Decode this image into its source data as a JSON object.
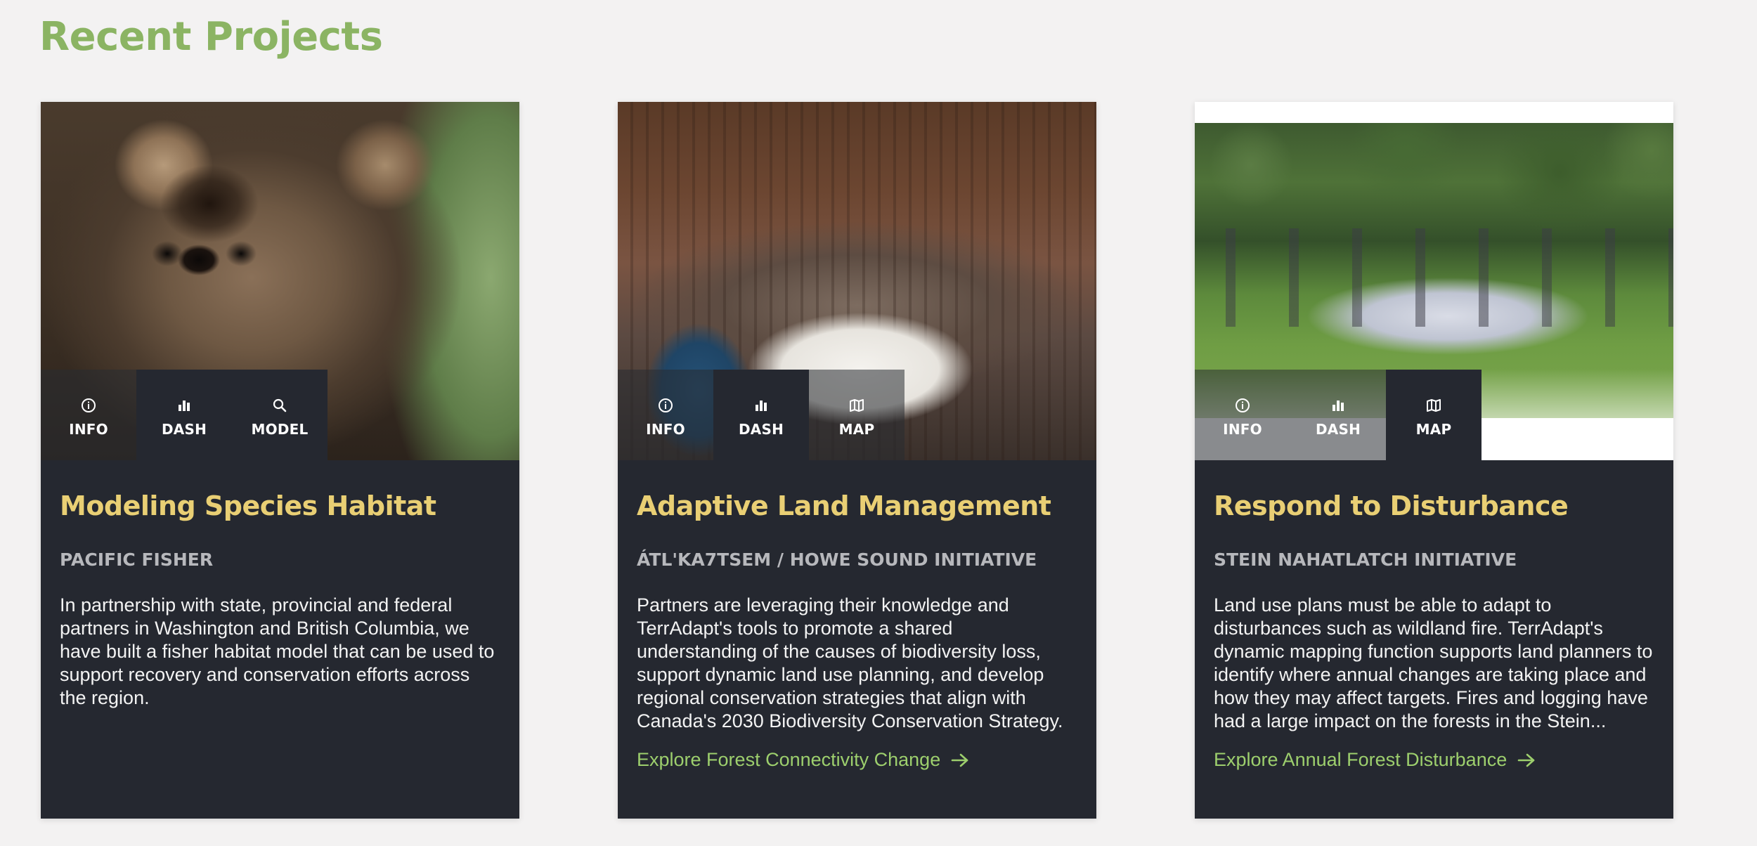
{
  "page": {
    "title": "Recent Projects"
  },
  "colors": {
    "title": "#8bb463",
    "card_bg": "#252830",
    "card_title": "#e9cf74",
    "subtitle": "#b7b8bc",
    "link": "#9dcf6d"
  },
  "cards": [
    {
      "title": "Modeling Species Habitat",
      "subtitle": "PACIFIC FISHER",
      "text": "In partnership with state, provincial and federal partners in Washington and British Columbia, we have built a fisher habitat model that can be used to support recovery and conservation efforts across the region.",
      "tabs": [
        {
          "label": "INFO",
          "icon": "info-icon"
        },
        {
          "label": "DASH",
          "icon": "bar-chart-icon"
        },
        {
          "label": "MODEL",
          "icon": "search-icon"
        }
      ]
    },
    {
      "title": "Adaptive Land Management",
      "subtitle": "ÁTL'KA7TSEM / HOWE SOUND INITIATIVE",
      "text": "Partners are leveraging their knowledge and TerrAdapt's tools to promote a shared understanding of the causes of biodiversity loss, support dynamic land use planning, and develop regional conservation strategies that align with Canada's 2030 Biodiversity Conservation Strategy.",
      "link": "Explore Forest Connectivity Change",
      "tabs": [
        {
          "label": "INFO",
          "icon": "info-icon"
        },
        {
          "label": "DASH",
          "icon": "bar-chart-icon"
        },
        {
          "label": "MAP",
          "icon": "map-icon"
        }
      ]
    },
    {
      "title": "Respond to Disturbance",
      "subtitle": "STEIN NAHATLATCH INITIATIVE",
      "text": "Land use plans must be able to adapt to disturbances such as wildland fire. TerrAdapt's dynamic mapping function supports land planners to identify where annual changes are taking place and how they may affect targets. Fires and logging have had a large impact on the forests in the Stein...",
      "link": "Explore Annual Forest Disturbance",
      "tabs": [
        {
          "label": "INFO",
          "icon": "info-icon"
        },
        {
          "label": "DASH",
          "icon": "bar-chart-icon"
        },
        {
          "label": "MAP",
          "icon": "map-icon"
        }
      ]
    }
  ]
}
